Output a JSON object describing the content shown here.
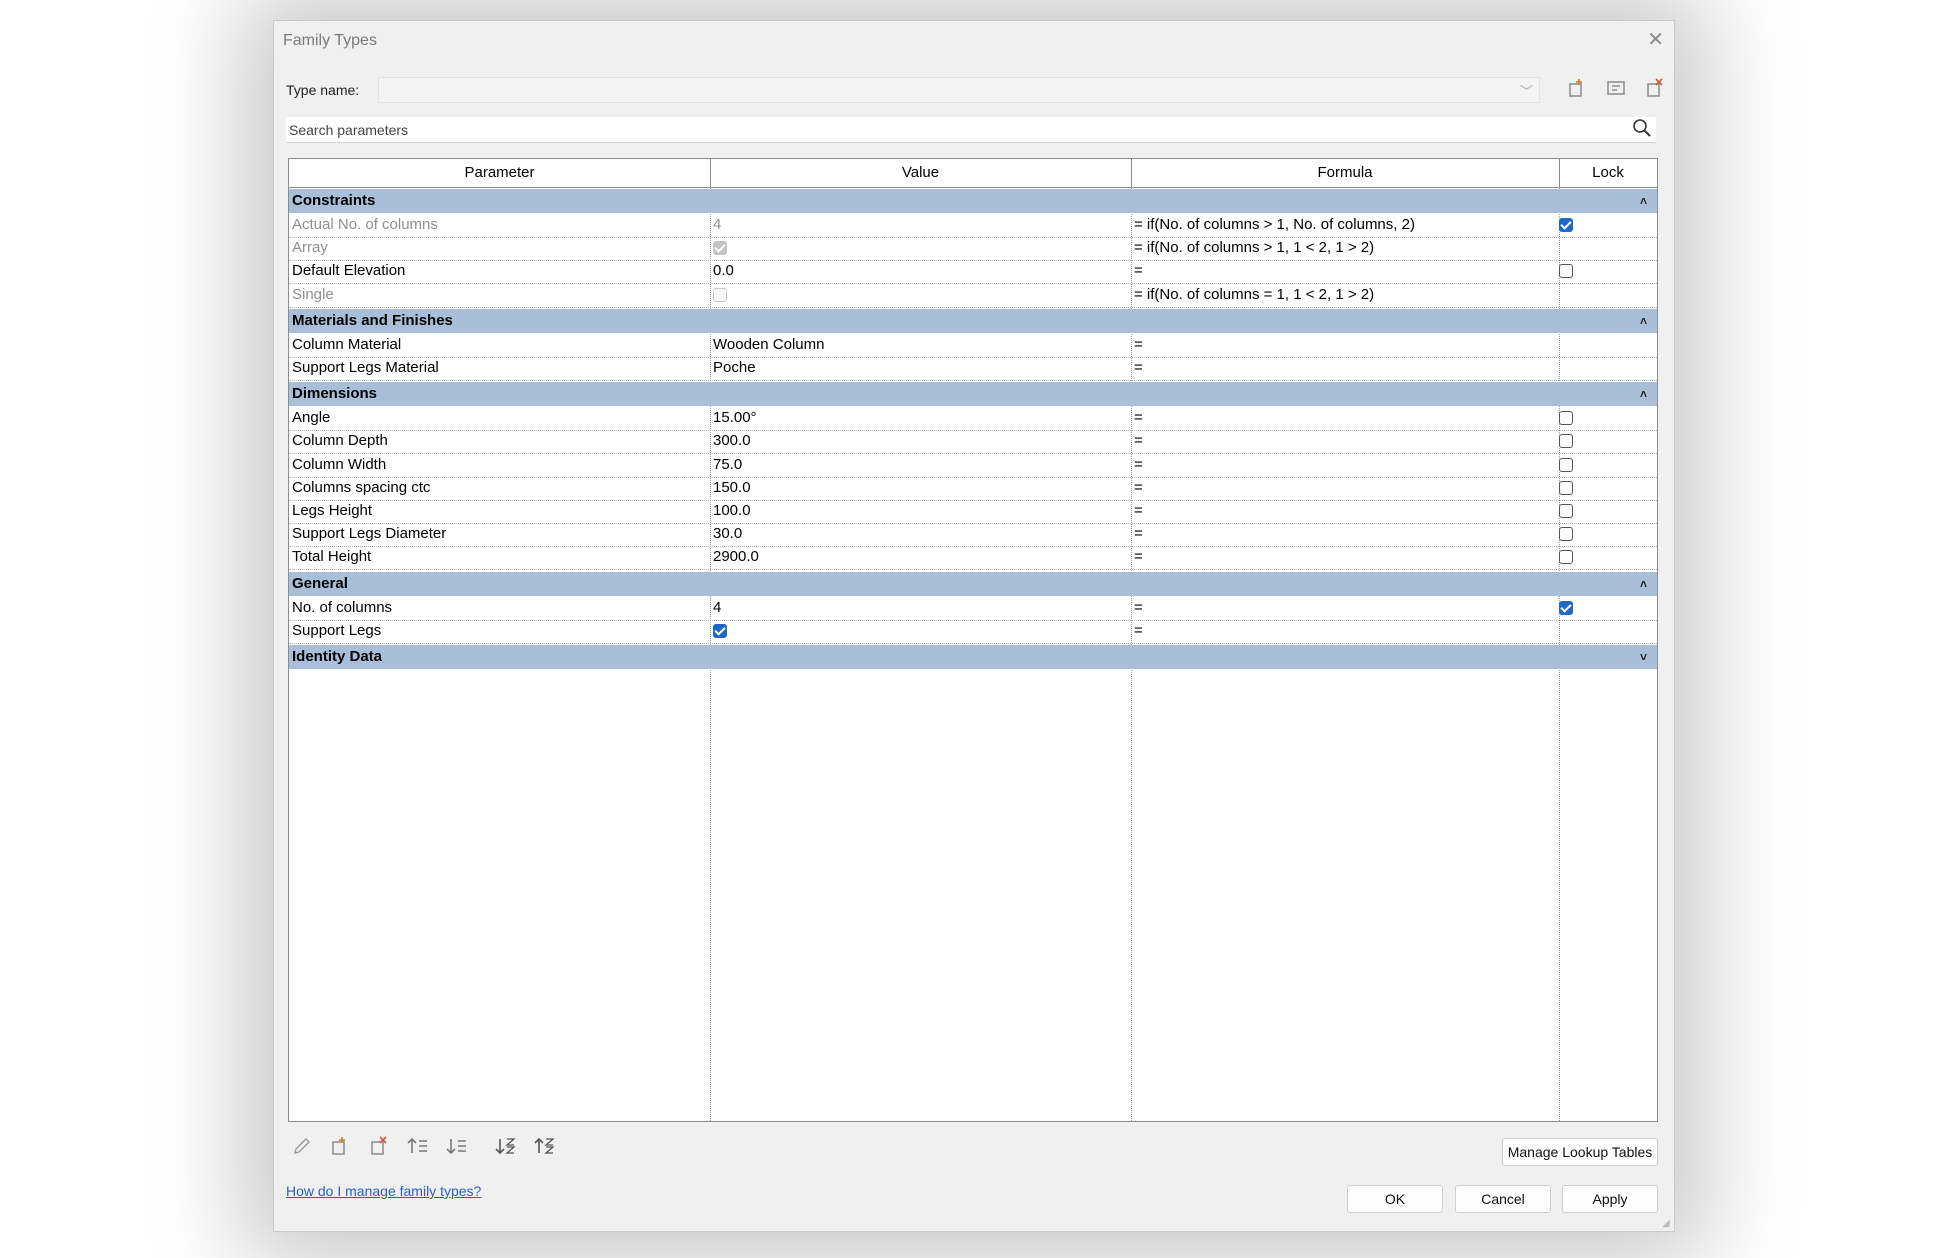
{
  "window": {
    "title": "Family Types"
  },
  "type_name": {
    "label": "Type name:",
    "value": ""
  },
  "toolbar_icons": [
    "new-type-icon",
    "rename-type-icon",
    "delete-type-icon"
  ],
  "search": {
    "placeholder": "Search parameters"
  },
  "columns": {
    "parameter": "Parameter",
    "value": "Value",
    "formula": "Formula",
    "lock": "Lock"
  },
  "groups": [
    {
      "name": "Constraints",
      "toggle": "˄",
      "rows": [
        {
          "parameter": "Actual No. of columns",
          "value": "4",
          "formula": "= if(No. of columns > 1, No. of columns, 2)",
          "lock": true,
          "grey": true
        },
        {
          "parameter": "Array",
          "value_checkbox": true,
          "formula": "= if(No. of columns > 1, 1 < 2, 1 > 2)",
          "grey": true
        },
        {
          "parameter": "Default Elevation",
          "value": "0.0",
          "formula": "=",
          "lock": false
        },
        {
          "parameter": "Single",
          "value_checkbox": false,
          "formula": "= if(No. of columns = 1, 1 < 2, 1 > 2)",
          "grey": true
        }
      ]
    },
    {
      "name": "Materials and Finishes",
      "toggle": "˄",
      "rows": [
        {
          "parameter": "Column Material",
          "value": "Wooden Column",
          "formula": "="
        },
        {
          "parameter": "Support Legs Material",
          "value": "Poche",
          "formula": "="
        }
      ]
    },
    {
      "name": "Dimensions",
      "toggle": "˄",
      "rows": [
        {
          "parameter": "Angle",
          "value": "15.00°",
          "formula": "=",
          "lock": false
        },
        {
          "parameter": "Column Depth",
          "value": "300.0",
          "formula": "=",
          "lock": false
        },
        {
          "parameter": "Column Width",
          "value": "75.0",
          "formula": "=",
          "lock": false
        },
        {
          "parameter": "Columns spacing ctc",
          "value": "150.0",
          "formula": "=",
          "lock": false
        },
        {
          "parameter": "Legs Height",
          "value": "100.0",
          "formula": "=",
          "lock": false
        },
        {
          "parameter": "Support Legs Diameter",
          "value": "30.0",
          "formula": "=",
          "lock": false
        },
        {
          "parameter": "Total Height",
          "value": "2900.0",
          "formula": "=",
          "lock": false
        }
      ]
    },
    {
      "name": "General",
      "toggle": "˄",
      "rows": [
        {
          "parameter": "No. of columns",
          "value": "4",
          "formula": "=",
          "lock": true
        },
        {
          "parameter": "Support Legs",
          "value_checkbox": true,
          "formula": "="
        }
      ]
    },
    {
      "name": "Identity Data",
      "toggle": "˅",
      "rows": []
    }
  ],
  "bottom_toolbar": [
    "edit-pencil-icon",
    "new-parameter-icon",
    "delete-parameter-icon",
    "move-up-icon",
    "move-down-icon",
    "sort-ascending-icon",
    "sort-descending-icon"
  ],
  "buttons": {
    "manage_lookup": "Manage Lookup Tables",
    "ok": "OK",
    "cancel": "Cancel",
    "apply": "Apply"
  },
  "help_link": "How do I manage family types?"
}
